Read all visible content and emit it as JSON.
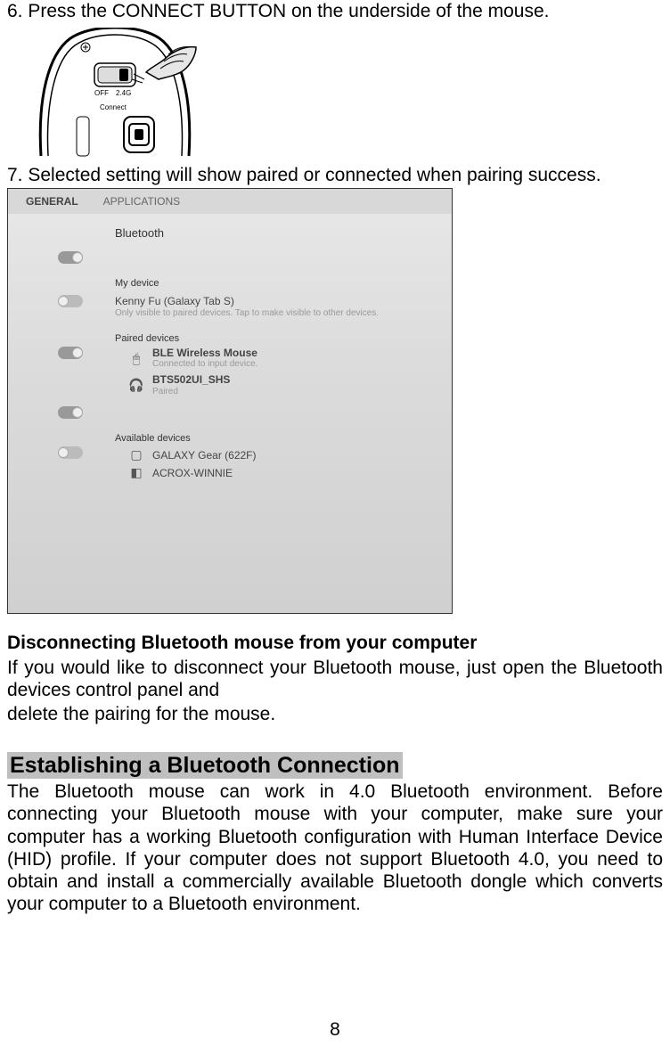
{
  "step6": "6. Press the CONNECT BUTTON on the underside of the mouse.",
  "diagram_labels": {
    "off": "OFF",
    "freq": "2.4G",
    "connect": "Connect"
  },
  "step7": "7. Selected setting will show paired or connected when pairing success.",
  "screenshot": {
    "tab_general": "GENERAL",
    "tab_apps": "APPLICATIONS",
    "bluetooth": "Bluetooth",
    "my_device": "My device",
    "my_device_name": "Kenny Fu (Galaxy Tab S)",
    "my_device_note": "Only visible to paired devices. Tap to make visible to other devices.",
    "paired": "Paired devices",
    "paired1_name": "BLE Wireless Mouse",
    "paired1_sub": "Connected to input device.",
    "paired2_name": "BTS502UI_SHS",
    "paired2_sub": "Paired",
    "available": "Available devices",
    "avail1": "GALAXY Gear (622F)",
    "avail2": "ACROX-WINNIE"
  },
  "disconnect_heading": "Disconnecting Bluetooth mouse from your computer",
  "disconnect_l1": "If you would like to disconnect your Bluetooth mouse, just open the Bluetooth devices control panel and",
  "disconnect_l2": "delete the pairing for the mouse.",
  "establish_heading": "Establishing a Bluetooth Connection",
  "establish_body": "The Bluetooth mouse can work in 4.0 Bluetooth environment. Before connecting your Bluetooth mouse with your computer, make sure your computer has a working Bluetooth configuration with Human Interface Device (HID) profile. If your computer does not support Bluetooth 4.0, you need to obtain and install a commercially available Bluetooth dongle which converts your computer to a Bluetooth environment.",
  "page_number": "8"
}
